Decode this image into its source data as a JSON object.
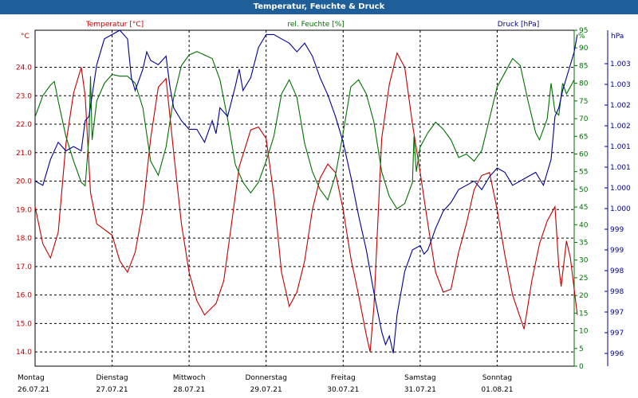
{
  "window": {
    "title": "Temperatur, Feuchte & Druck"
  },
  "chart_data": {
    "type": "line",
    "title": "Temperatur, Feuchte & Druck",
    "x": {
      "range": [
        0,
        7
      ],
      "day_labels": [
        "Montag",
        "Dienstag",
        "Mittwoch",
        "Donnerstag",
        "Freitag",
        "Samstag",
        "Sonntag"
      ],
      "date_labels": [
        "26.07.21",
        "27.07.21",
        "28.07.21",
        "29.07.21",
        "30.07.21",
        "31.07.21",
        "01.08.21"
      ]
    },
    "axes": {
      "temperature": {
        "unit_label": "°C",
        "range": [
          13.5,
          25.3
        ],
        "ticks": [
          "14.0",
          "15.0",
          "16.0",
          "17.0",
          "18.0",
          "19.0",
          "20.0",
          "21.0",
          "22.0",
          "23.0",
          "24.0"
        ]
      },
      "humidity": {
        "unit_label": "%",
        "range": [
          0,
          95
        ],
        "ticks": [
          "0",
          "5",
          "10",
          "15",
          "20",
          "25",
          "30",
          "35",
          "40",
          "45",
          "50",
          "55",
          "60",
          "65",
          "70",
          "75",
          "80",
          "85",
          "90",
          "95"
        ]
      },
      "pressure": {
        "unit_label": "hPa",
        "range": [
          995.8,
          1003.6
        ],
        "ticks": [
          "996",
          "997",
          "997",
          "998",
          "998",
          "999",
          "999",
          "1.000",
          "1.000",
          "1.001",
          "1.001",
          "1.002",
          "1.002",
          "1.003",
          "1.003"
        ]
      }
    },
    "grid": true,
    "series": [
      {
        "name": "Temperatur [°C]",
        "color": "#c00000",
        "axis": "temperature",
        "points": [
          [
            0.0,
            19.1
          ],
          [
            0.1,
            17.8
          ],
          [
            0.2,
            17.3
          ],
          [
            0.3,
            18.2
          ],
          [
            0.4,
            21.3
          ],
          [
            0.5,
            23.1
          ],
          [
            0.6,
            24.0
          ],
          [
            0.65,
            23.0
          ],
          [
            0.72,
            19.6
          ],
          [
            0.8,
            18.5
          ],
          [
            1.0,
            18.1
          ],
          [
            1.1,
            17.2
          ],
          [
            1.2,
            16.8
          ],
          [
            1.3,
            17.5
          ],
          [
            1.4,
            19.0
          ],
          [
            1.5,
            21.5
          ],
          [
            1.6,
            23.3
          ],
          [
            1.7,
            23.6
          ],
          [
            1.8,
            21.0
          ],
          [
            1.9,
            18.5
          ],
          [
            2.0,
            16.8
          ],
          [
            2.1,
            15.8
          ],
          [
            2.2,
            15.3
          ],
          [
            2.35,
            15.7
          ],
          [
            2.45,
            16.5
          ],
          [
            2.55,
            18.5
          ],
          [
            2.65,
            20.5
          ],
          [
            2.8,
            21.8
          ],
          [
            2.9,
            21.9
          ],
          [
            3.0,
            21.5
          ],
          [
            3.1,
            19.5
          ],
          [
            3.2,
            16.8
          ],
          [
            3.3,
            15.6
          ],
          [
            3.4,
            16.1
          ],
          [
            3.5,
            17.2
          ],
          [
            3.6,
            19.0
          ],
          [
            3.7,
            20.1
          ],
          [
            3.8,
            20.6
          ],
          [
            3.9,
            20.3
          ],
          [
            4.0,
            19.0
          ],
          [
            4.1,
            17.3
          ],
          [
            4.2,
            16.0
          ],
          [
            4.3,
            14.6
          ],
          [
            4.35,
            14.0
          ],
          [
            4.4,
            15.6
          ],
          [
            4.5,
            21.5
          ],
          [
            4.6,
            23.4
          ],
          [
            4.7,
            24.5
          ],
          [
            4.8,
            24.0
          ],
          [
            4.9,
            22.0
          ],
          [
            5.0,
            20.3
          ],
          [
            5.1,
            18.5
          ],
          [
            5.2,
            16.8
          ],
          [
            5.3,
            16.1
          ],
          [
            5.4,
            16.2
          ],
          [
            5.5,
            17.5
          ],
          [
            5.6,
            18.5
          ],
          [
            5.7,
            19.7
          ],
          [
            5.8,
            20.2
          ],
          [
            5.9,
            20.3
          ],
          [
            6.0,
            19.0
          ],
          [
            6.1,
            17.4
          ],
          [
            6.2,
            16.0
          ],
          [
            6.3,
            15.2
          ],
          [
            6.35,
            14.8
          ],
          [
            6.45,
            16.5
          ],
          [
            6.55,
            17.8
          ],
          [
            6.65,
            18.6
          ],
          [
            6.75,
            19.1
          ],
          [
            6.8,
            17.0
          ],
          [
            6.83,
            16.3
          ],
          [
            6.9,
            17.9
          ],
          [
            6.95,
            17.3
          ],
          [
            7.0,
            16.2
          ],
          [
            7.1,
            15.3
          ]
        ]
      },
      {
        "name": "rel. Feuchte [%]",
        "color": "#007000",
        "axis": "humidity",
        "points": [
          [
            0.0,
            70.5
          ],
          [
            0.1,
            76.5
          ],
          [
            0.2,
            79.5
          ],
          [
            0.25,
            80.5
          ],
          [
            0.3,
            75
          ],
          [
            0.4,
            65
          ],
          [
            0.5,
            58
          ],
          [
            0.6,
            52
          ],
          [
            0.65,
            51
          ],
          [
            0.7,
            65
          ],
          [
            0.72,
            82
          ],
          [
            0.74,
            64
          ],
          [
            0.8,
            75
          ],
          [
            0.9,
            80
          ],
          [
            1.0,
            82.5
          ],
          [
            1.1,
            82
          ],
          [
            1.2,
            82
          ],
          [
            1.3,
            80
          ],
          [
            1.4,
            73
          ],
          [
            1.5,
            58
          ],
          [
            1.6,
            54
          ],
          [
            1.7,
            62
          ],
          [
            1.8,
            76
          ],
          [
            1.9,
            85
          ],
          [
            2.0,
            88
          ],
          [
            2.1,
            89
          ],
          [
            2.2,
            88
          ],
          [
            2.3,
            87
          ],
          [
            2.4,
            81
          ],
          [
            2.5,
            70
          ],
          [
            2.6,
            57
          ],
          [
            2.7,
            52
          ],
          [
            2.8,
            49
          ],
          [
            2.9,
            52
          ],
          [
            3.0,
            58
          ],
          [
            3.1,
            65
          ],
          [
            3.2,
            77
          ],
          [
            3.3,
            81
          ],
          [
            3.4,
            76
          ],
          [
            3.5,
            63
          ],
          [
            3.6,
            55
          ],
          [
            3.7,
            50
          ],
          [
            3.8,
            47
          ],
          [
            3.9,
            54
          ],
          [
            4.0,
            66
          ],
          [
            4.1,
            79
          ],
          [
            4.2,
            81
          ],
          [
            4.3,
            77
          ],
          [
            4.4,
            69
          ],
          [
            4.5,
            55
          ],
          [
            4.6,
            48
          ],
          [
            4.7,
            44.5
          ],
          [
            4.8,
            46
          ],
          [
            4.9,
            52
          ],
          [
            4.92,
            65
          ],
          [
            4.95,
            55
          ],
          [
            5.0,
            62
          ],
          [
            5.1,
            66
          ],
          [
            5.2,
            69
          ],
          [
            5.3,
            67
          ],
          [
            5.4,
            64
          ],
          [
            5.5,
            59
          ],
          [
            5.6,
            60
          ],
          [
            5.7,
            58
          ],
          [
            5.8,
            61
          ],
          [
            5.9,
            70
          ],
          [
            6.0,
            79
          ],
          [
            6.1,
            83
          ],
          [
            6.2,
            87
          ],
          [
            6.3,
            85
          ],
          [
            6.4,
            75
          ],
          [
            6.5,
            66
          ],
          [
            6.55,
            64
          ],
          [
            6.65,
            70
          ],
          [
            6.7,
            80
          ],
          [
            6.75,
            72
          ],
          [
            6.8,
            71
          ],
          [
            6.85,
            80
          ],
          [
            6.9,
            77
          ],
          [
            7.0,
            81
          ]
        ]
      },
      {
        "name": "Druck [hPa]",
        "color": "#000090",
        "axis": "pressure",
        "points": [
          [
            0.0,
            1000.1
          ],
          [
            0.1,
            1000.0
          ],
          [
            0.2,
            1000.6
          ],
          [
            0.3,
            1001.0
          ],
          [
            0.4,
            1000.8
          ],
          [
            0.5,
            1000.9
          ],
          [
            0.6,
            1000.8
          ],
          [
            0.65,
            1001.5
          ],
          [
            0.7,
            1001.6
          ],
          [
            0.8,
            1002.8
          ],
          [
            0.9,
            1003.4
          ],
          [
            1.0,
            1003.5
          ],
          [
            1.1,
            1003.6
          ],
          [
            1.2,
            1003.4
          ],
          [
            1.25,
            1002.5
          ],
          [
            1.3,
            1002.2
          ],
          [
            1.4,
            1002.7
          ],
          [
            1.45,
            1003.1
          ],
          [
            1.5,
            1002.9
          ],
          [
            1.6,
            1002.8
          ],
          [
            1.7,
            1003.0
          ],
          [
            1.75,
            1002.3
          ],
          [
            1.8,
            1001.8
          ],
          [
            1.9,
            1001.5
          ],
          [
            2.0,
            1001.3
          ],
          [
            2.1,
            1001.3
          ],
          [
            2.2,
            1001.0
          ],
          [
            2.3,
            1001.5
          ],
          [
            2.35,
            1001.2
          ],
          [
            2.4,
            1001.8
          ],
          [
            2.5,
            1001.6
          ],
          [
            2.6,
            1002.3
          ],
          [
            2.65,
            1002.7
          ],
          [
            2.7,
            1002.2
          ],
          [
            2.8,
            1002.5
          ],
          [
            2.9,
            1003.2
          ],
          [
            3.0,
            1003.5
          ],
          [
            3.1,
            1003.5
          ],
          [
            3.2,
            1003.4
          ],
          [
            3.3,
            1003.3
          ],
          [
            3.4,
            1003.1
          ],
          [
            3.5,
            1003.3
          ],
          [
            3.6,
            1003.0
          ],
          [
            3.7,
            1002.5
          ],
          [
            3.8,
            1002.1
          ],
          [
            3.9,
            1001.6
          ],
          [
            4.0,
            1001.0
          ],
          [
            4.1,
            1000.2
          ],
          [
            4.2,
            999.3
          ],
          [
            4.3,
            998.5
          ],
          [
            4.4,
            997.5
          ],
          [
            4.5,
            996.6
          ],
          [
            4.55,
            996.3
          ],
          [
            4.6,
            996.5
          ],
          [
            4.65,
            996.1
          ],
          [
            4.7,
            997.0
          ],
          [
            4.8,
            998.0
          ],
          [
            4.9,
            998.5
          ],
          [
            5.0,
            998.6
          ],
          [
            5.05,
            998.4
          ],
          [
            5.1,
            998.5
          ],
          [
            5.2,
            999.0
          ],
          [
            5.3,
            999.4
          ],
          [
            5.4,
            999.6
          ],
          [
            5.5,
            999.9
          ],
          [
            5.6,
            1000.0
          ],
          [
            5.7,
            1000.1
          ],
          [
            5.8,
            999.9
          ],
          [
            5.9,
            1000.2
          ],
          [
            6.0,
            1000.4
          ],
          [
            6.1,
            1000.3
          ],
          [
            6.2,
            1000.0
          ],
          [
            6.3,
            1000.1
          ],
          [
            6.4,
            1000.2
          ],
          [
            6.5,
            1000.3
          ],
          [
            6.6,
            1000.0
          ],
          [
            6.7,
            1000.6
          ],
          [
            6.75,
            1001.6
          ],
          [
            6.8,
            1001.8
          ],
          [
            6.85,
            1002.2
          ],
          [
            6.9,
            1002.5
          ],
          [
            6.95,
            1002.8
          ],
          [
            7.0,
            1003.1
          ],
          [
            7.1,
            1003.5
          ]
        ]
      }
    ]
  }
}
